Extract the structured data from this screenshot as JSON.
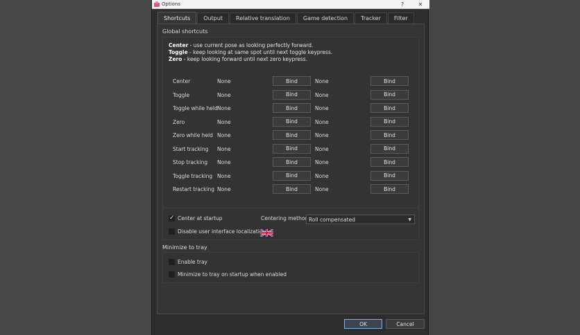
{
  "window": {
    "title": "Options",
    "help_label": "?",
    "close_label": "✕"
  },
  "tabs": [
    {
      "label": "Shortcuts"
    },
    {
      "label": "Output"
    },
    {
      "label": "Relative translation"
    },
    {
      "label": "Game detection"
    },
    {
      "label": "Tracker"
    },
    {
      "label": "Filter"
    }
  ],
  "global_shortcuts": {
    "title": "Global shortcuts",
    "descriptions": [
      {
        "key": "Center",
        "text": " - use current pose as looking perfectly forward."
      },
      {
        "key": "Toggle",
        "text": " - keep looking at same spot until next toggle keypress."
      },
      {
        "key": "Zero",
        "text": " - keep looking forward until next zero keypress."
      }
    ],
    "rows": [
      {
        "label": "Center",
        "key1": "None",
        "bind1": "Bind",
        "key2": "None",
        "bind2": "Bind"
      },
      {
        "label": "Toggle",
        "key1": "None",
        "bind1": "Bind",
        "key2": "None",
        "bind2": "Bind"
      },
      {
        "label": "Toggle while held",
        "key1": "None",
        "bind1": "Bind",
        "key2": "None",
        "bind2": "Bind"
      },
      {
        "label": "Zero",
        "key1": "None",
        "bind1": "Bind",
        "key2": "None",
        "bind2": "Bind"
      },
      {
        "label": "Zero while held",
        "key1": "None",
        "bind1": "Bind",
        "key2": "None",
        "bind2": "Bind"
      },
      {
        "label": "Start tracking",
        "key1": "None",
        "bind1": "Bind",
        "key2": "None",
        "bind2": "Bind"
      },
      {
        "label": "Stop tracking",
        "key1": "None",
        "bind1": "Bind",
        "key2": "None",
        "bind2": "Bind"
      },
      {
        "label": "Toggle tracking",
        "key1": "None",
        "bind1": "Bind",
        "key2": "None",
        "bind2": "Bind"
      },
      {
        "label": "Restart tracking",
        "key1": "None",
        "bind1": "Bind",
        "key2": "None",
        "bind2": "Bind"
      }
    ]
  },
  "startup": {
    "center_at_startup": {
      "label": "Center at startup",
      "checked": true
    },
    "centering_method_label": "Centering method",
    "centering_method_value": "Roll compensated",
    "disable_localization": {
      "label": "Disable user interface localization",
      "checked": false
    },
    "flag_icon": "uk-flag-icon"
  },
  "tray": {
    "title": "Minimize to tray",
    "enable_tray": {
      "label": "Enable tray",
      "checked": false
    },
    "minimize_on_startup": {
      "label": "Minimize to tray on startup when enabled",
      "checked": false
    }
  },
  "footer": {
    "ok_label": "OK",
    "cancel_label": "Cancel"
  },
  "colors": {
    "background": "#2d2d2d",
    "panel": "#353535",
    "titlebar": "#f4f4f4",
    "ok_border": "#8ab0d8"
  }
}
